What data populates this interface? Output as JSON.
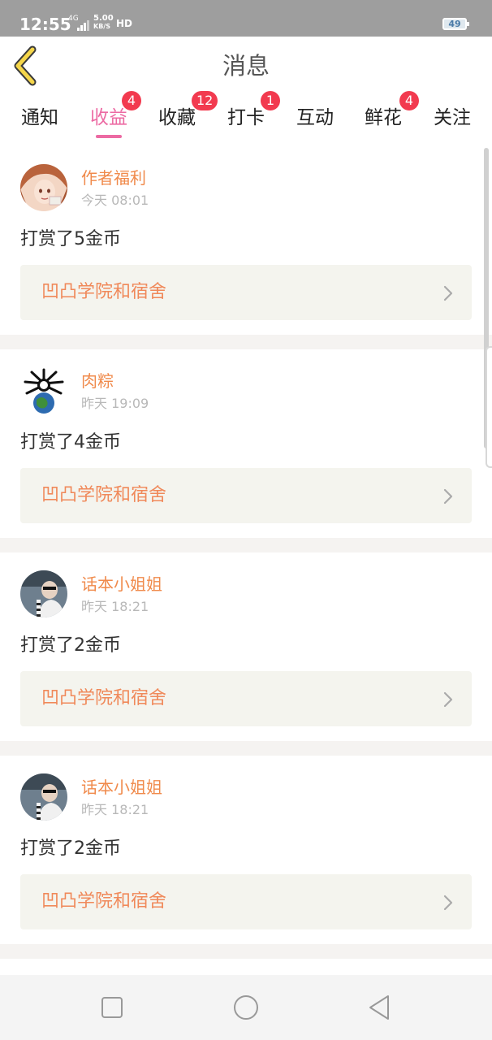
{
  "status_bar": {
    "time": "12:55",
    "network": "4G",
    "speed_value": "5.00",
    "speed_unit": "KB/S",
    "hd": "HD",
    "battery": "49"
  },
  "header": {
    "title": "消息",
    "back_icon": "chevron-left-icon"
  },
  "tabs": [
    {
      "label": "通知",
      "badge": ""
    },
    {
      "label": "收益",
      "badge": "4",
      "active": true
    },
    {
      "label": "收藏",
      "badge": "12"
    },
    {
      "label": "打卡",
      "badge": "1"
    },
    {
      "label": "互动",
      "badge": ""
    },
    {
      "label": "鲜花",
      "badge": "4"
    },
    {
      "label": "关注",
      "badge": ""
    }
  ],
  "messages": [
    {
      "author": "作者福利",
      "time": "今天 08:01",
      "action": "打赏了5金币",
      "link": "凹凸学院和宿舍"
    },
    {
      "author": "肉粽",
      "time": "昨天 19:09",
      "action": "打赏了4金币",
      "link": "凹凸学院和宿舍"
    },
    {
      "author": "话本小姐姐",
      "time": "昨天 18:21",
      "action": "打赏了2金币",
      "link": "凹凸学院和宿舍"
    },
    {
      "author": "话本小姐姐",
      "time": "昨天 18:21",
      "action": "打赏了2金币",
      "link": "凹凸学院和宿舍"
    }
  ],
  "colors": {
    "accent": "#ec6aa3",
    "badge": "#f23a4f",
    "author": "#f08a4b",
    "link": "#f0895a"
  }
}
